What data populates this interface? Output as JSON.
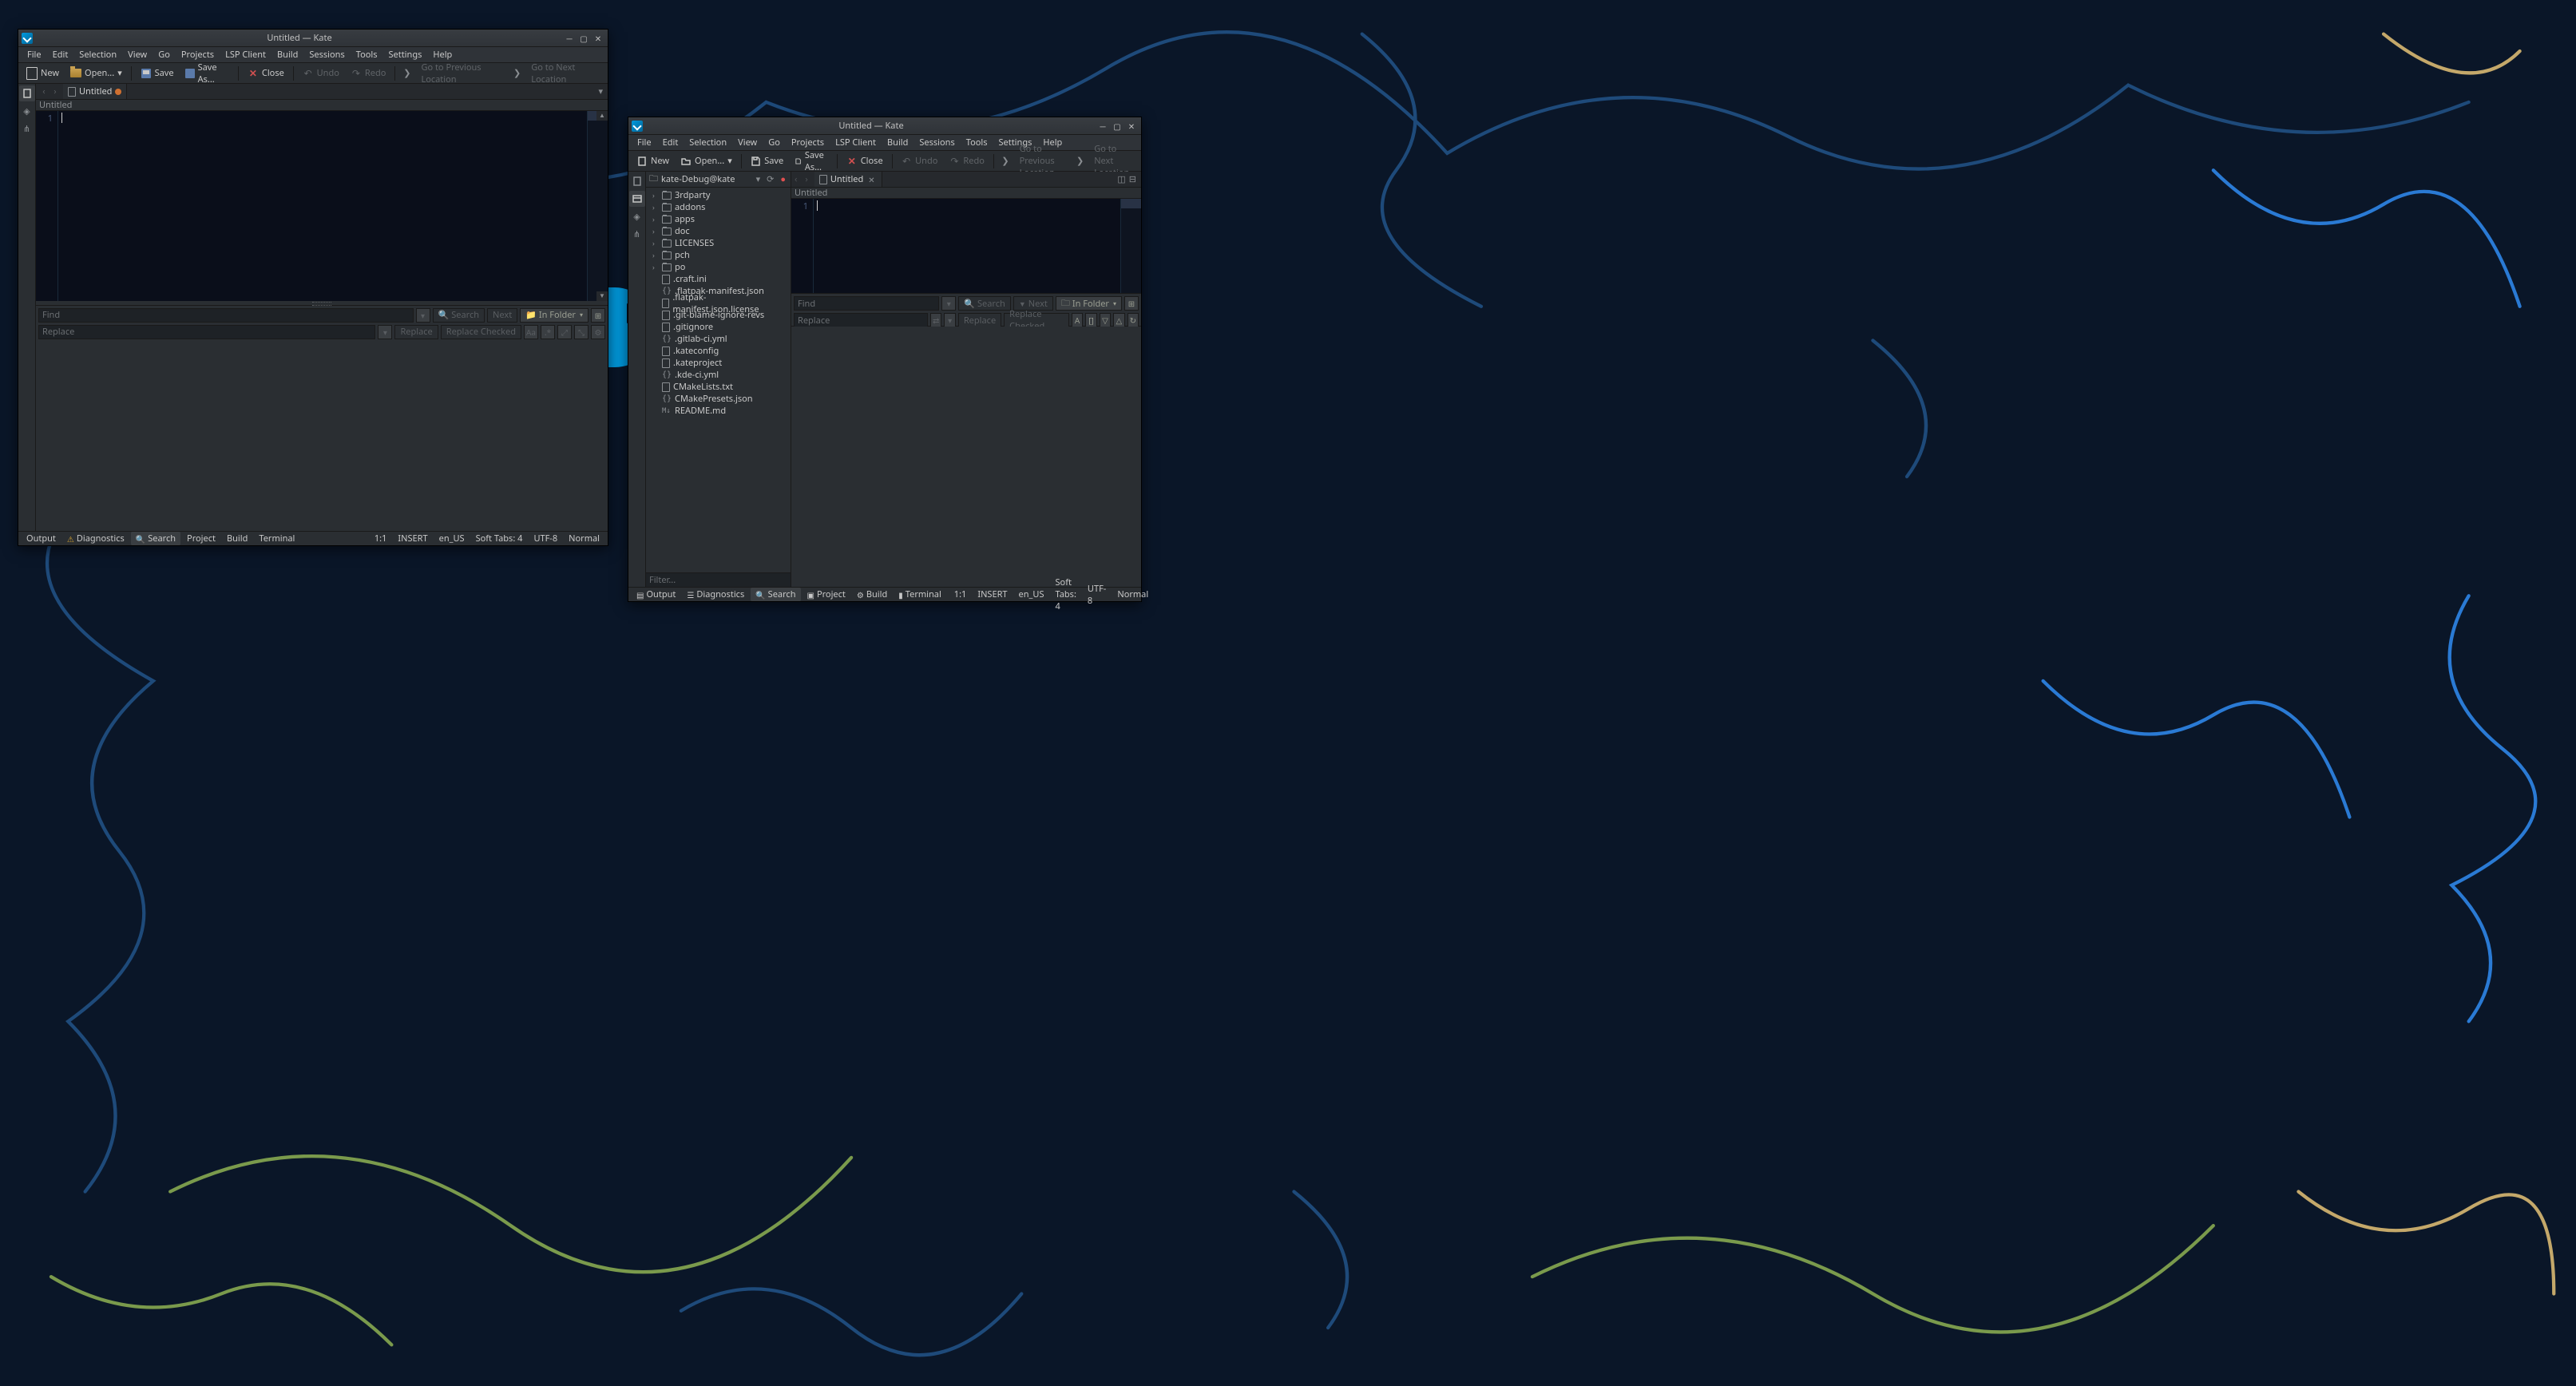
{
  "window1": {
    "title": "Untitled  — Kate",
    "menu": [
      "File",
      "Edit",
      "Selection",
      "View",
      "Go",
      "Projects",
      "LSP Client",
      "Build",
      "Sessions",
      "Tools",
      "Settings",
      "Help"
    ],
    "toolbar": {
      "new": "New",
      "open": "Open...",
      "save": "Save",
      "saveas": "Save As...",
      "close": "Close",
      "undo": "Undo",
      "redo": "Redo",
      "prev_loc": "Go to Previous Location",
      "next_loc": "Go to Next Location"
    },
    "tab": {
      "label": "Untitled"
    },
    "path": "Untitled",
    "line_no": "1",
    "search": {
      "find_ph": "Find",
      "replace_ph": "Replace",
      "search_btn": "Search",
      "next_btn": "Next",
      "folder_btn": "In Folder",
      "replace_btn": "Replace",
      "replace_checked": "Replace Checked"
    },
    "bottom": {
      "tabs": [
        "Output",
        "Diagnostics",
        "Search",
        "Project",
        "Build",
        "Terminal"
      ]
    },
    "status": {
      "pos": "1:1",
      "mode": "INSERT",
      "locale": "en_US",
      "indent": "Soft Tabs: 4",
      "encoding": "UTF-8",
      "lang": "Normal"
    }
  },
  "window2": {
    "title": "Untitled  — Kate",
    "menu": [
      "File",
      "Edit",
      "Selection",
      "View",
      "Go",
      "Projects",
      "LSP Client",
      "Build",
      "Sessions",
      "Tools",
      "Settings",
      "Help"
    ],
    "toolbar": {
      "new": "New",
      "open": "Open...",
      "save": "Save",
      "saveas": "Save As...",
      "close": "Close",
      "undo": "Undo",
      "redo": "Redo",
      "prev_loc": "Go to Previous Location",
      "next_loc": "Go to Next Location"
    },
    "project": {
      "name": "kate-Debug@kate",
      "tree": [
        {
          "type": "folder",
          "name": "3rdparty"
        },
        {
          "type": "folder",
          "name": "addons"
        },
        {
          "type": "folder",
          "name": "apps"
        },
        {
          "type": "folder",
          "name": "doc"
        },
        {
          "type": "folder",
          "name": "LICENSES"
        },
        {
          "type": "folder",
          "name": "pch"
        },
        {
          "type": "folder",
          "name": "po"
        },
        {
          "type": "file",
          "name": ".craft.ini",
          "icon": "file"
        },
        {
          "type": "file",
          "name": ".flatpak-manifest.json",
          "icon": "braces"
        },
        {
          "type": "file",
          "name": ".flatpak-manifest.json.license",
          "icon": "file"
        },
        {
          "type": "file",
          "name": ".git-blame-ignore-revs",
          "icon": "file"
        },
        {
          "type": "file",
          "name": ".gitignore",
          "icon": "file"
        },
        {
          "type": "file",
          "name": ".gitlab-ci.yml",
          "icon": "braces"
        },
        {
          "type": "file",
          "name": ".kateconfig",
          "icon": "file"
        },
        {
          "type": "file",
          "name": ".kateproject",
          "icon": "file"
        },
        {
          "type": "file",
          "name": ".kde-ci.yml",
          "icon": "braces"
        },
        {
          "type": "file",
          "name": "CMakeLists.txt",
          "icon": "file"
        },
        {
          "type": "file",
          "name": "CMakePresets.json",
          "icon": "braces"
        },
        {
          "type": "file",
          "name": "README.md",
          "icon": "md"
        }
      ],
      "filter_ph": "Filter..."
    },
    "tab": {
      "label": "Untitled"
    },
    "path": "Untitled",
    "line_no": "1",
    "search": {
      "find_ph": "Find",
      "replace_ph": "Replace",
      "search_btn": "Search",
      "next_btn": "Next",
      "folder_btn": "In Folder",
      "replace_btn": "Replace",
      "replace_checked": "Replace Checked"
    },
    "bottom": {
      "tabs": [
        "Output",
        "Diagnostics",
        "Search",
        "Project",
        "Build",
        "Terminal"
      ]
    },
    "status": {
      "pos": "1:1",
      "mode": "INSERT",
      "locale": "en_US",
      "indent": "Soft Tabs: 4",
      "encoding": "UTF-8",
      "lang": "Normal"
    }
  }
}
